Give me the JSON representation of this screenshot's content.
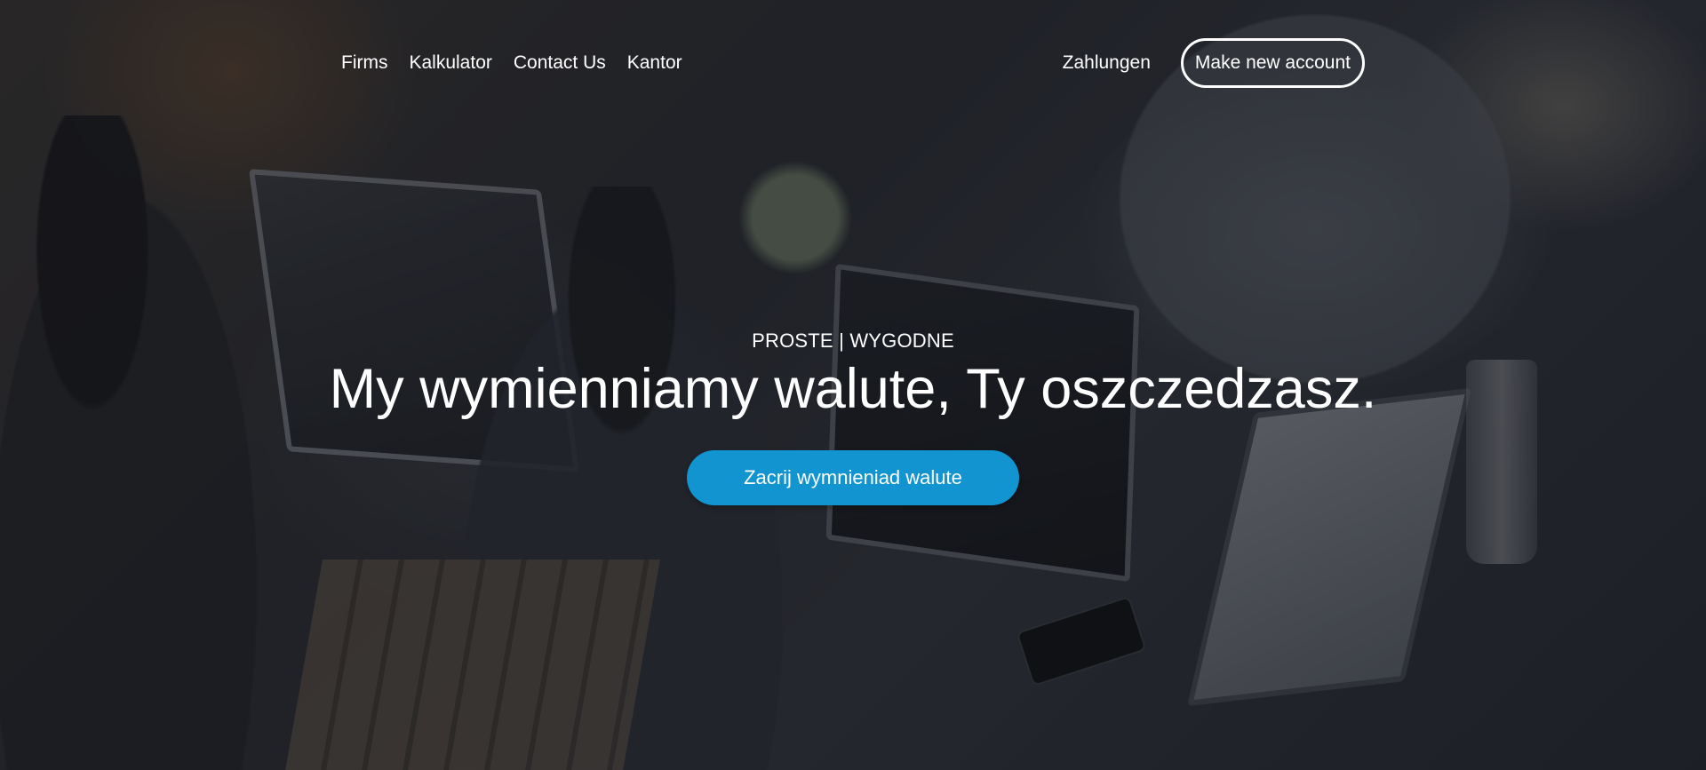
{
  "nav": {
    "left_links": [
      {
        "label": "Firms"
      },
      {
        "label": "Kalkulator"
      },
      {
        "label": "Contact Us"
      },
      {
        "label": "Kantor"
      }
    ],
    "right_link": "Zahlungen",
    "account_button": "Make new account"
  },
  "hero": {
    "eyebrow": "PROSTE | WYGODNE",
    "headline": "My wymienniamy walute, Ty oszczedzasz.",
    "cta_label": "Zacrij wymnieniad walute"
  },
  "colors": {
    "cta_background": "#1194cf",
    "text": "#ffffff"
  }
}
